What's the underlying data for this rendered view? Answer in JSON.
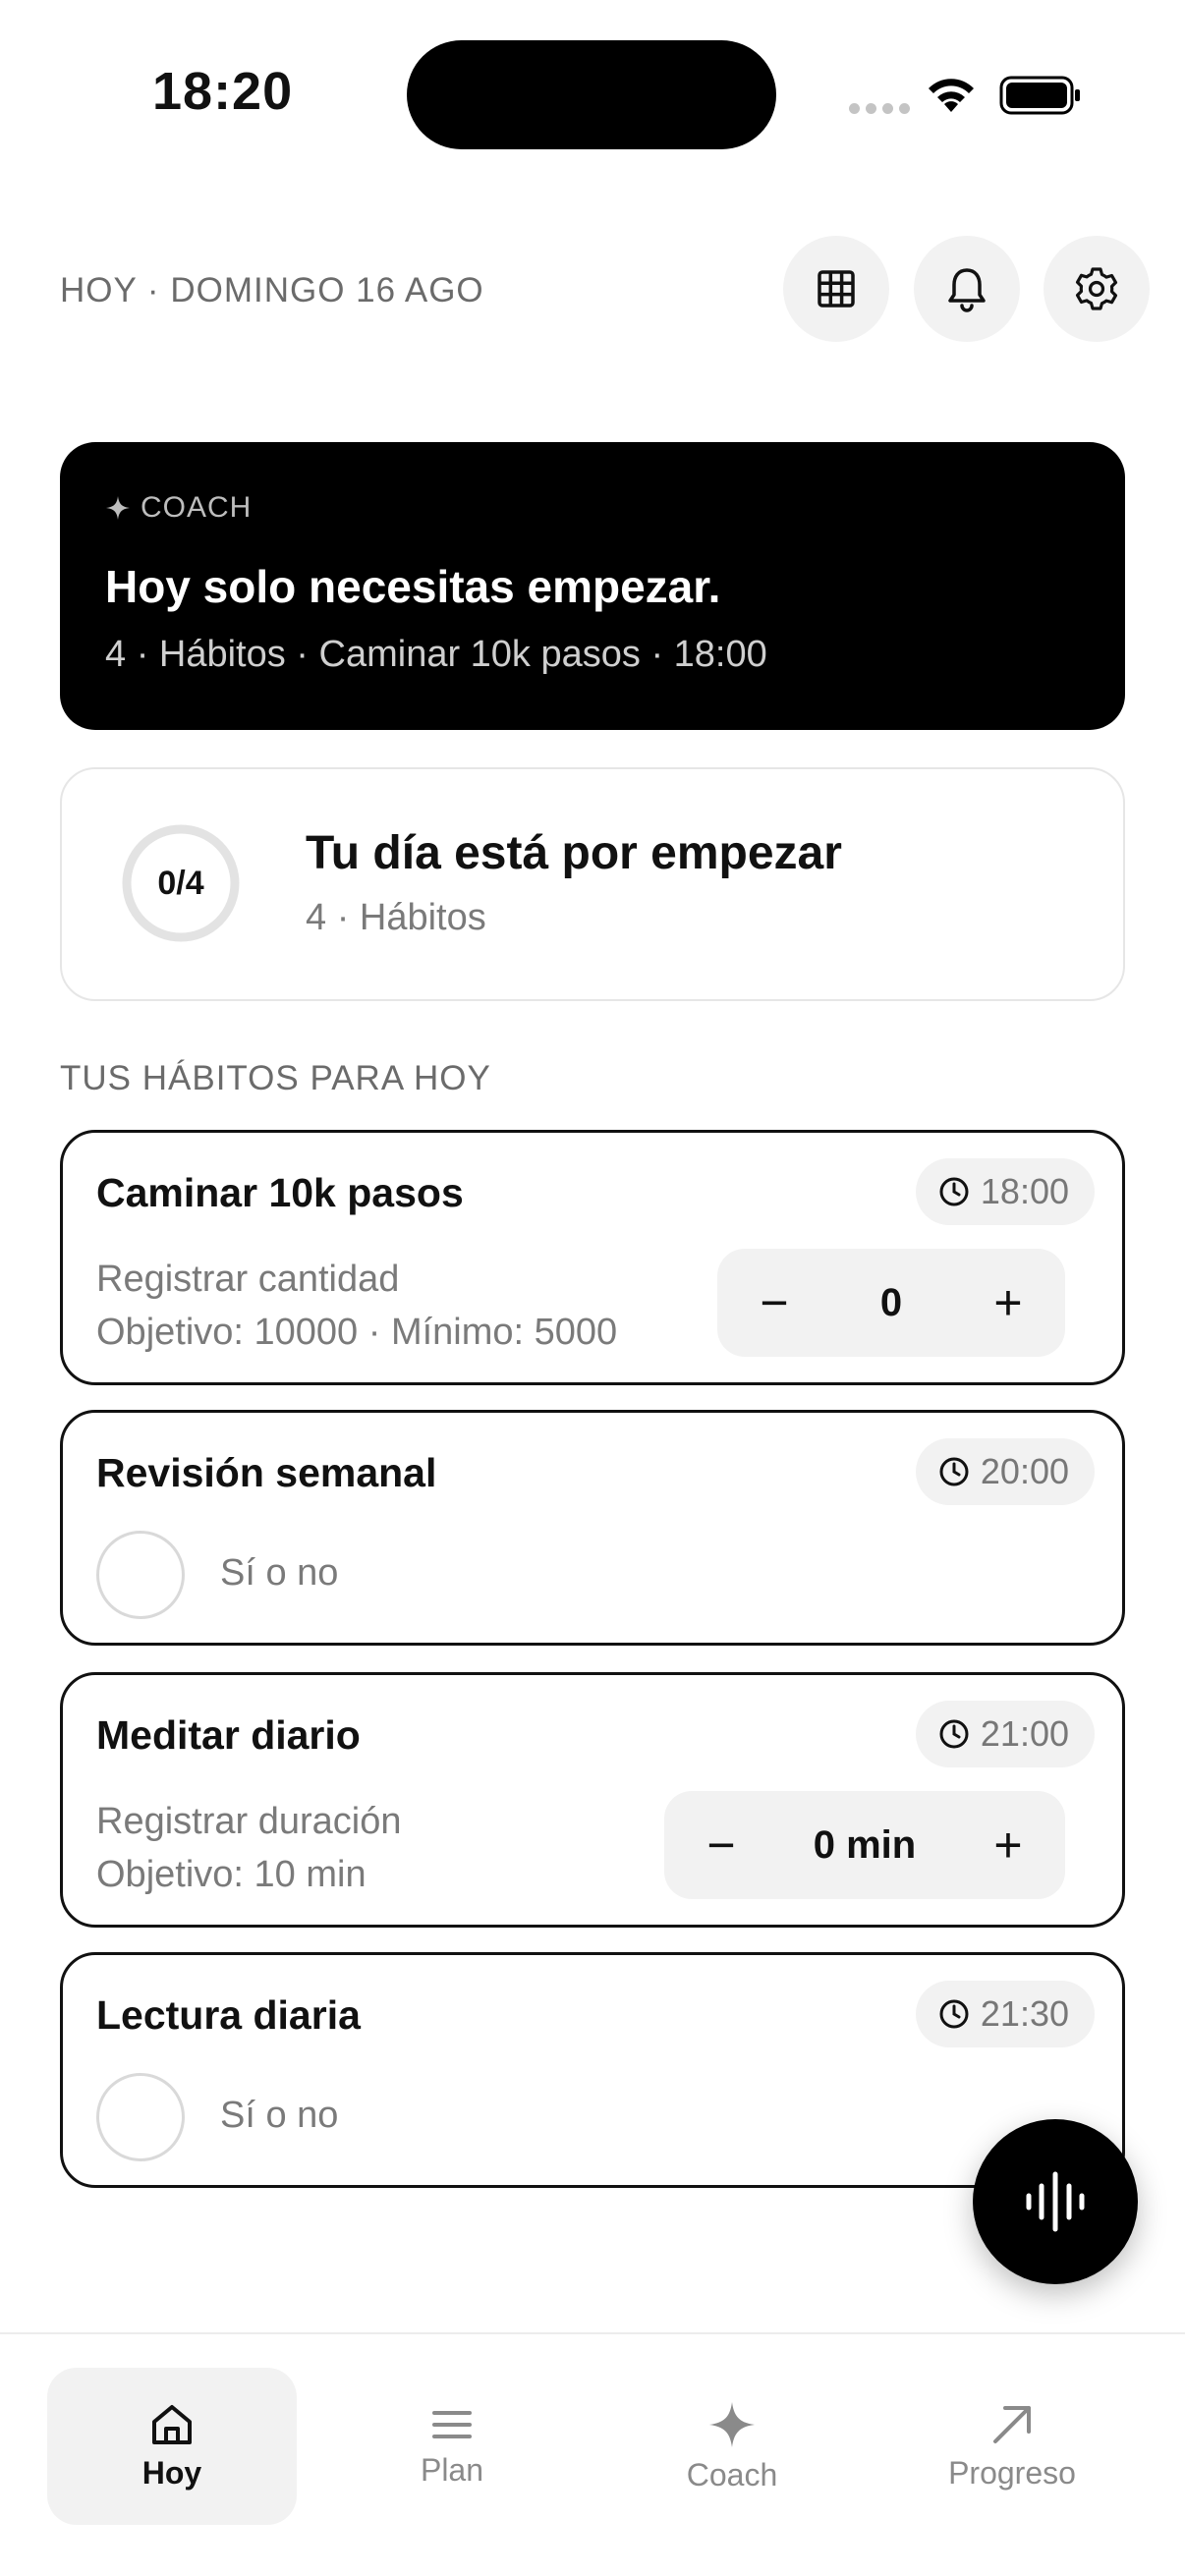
{
  "status_bar": {
    "time": "18:20"
  },
  "header": {
    "date_label": "HOY · DOMINGO 16 AGO"
  },
  "coach_card": {
    "kicker": "COACH",
    "title": "Hoy solo necesitas empezar.",
    "subtitle": "4 · Hábitos · Caminar 10k pasos · 18:00"
  },
  "progress_card": {
    "ring_label": "0/4",
    "completed_fraction": 0,
    "title": "Tu día está por empezar",
    "subtitle": "4 · Hábitos"
  },
  "section_title": "TUS HÁBITOS PARA HOY",
  "habits": [
    {
      "name": "Caminar 10k pasos",
      "time": "18:00",
      "line1": "Registrar cantidad",
      "line2": "Objetivo: 10000 · Mínimo: 5000",
      "value": "0",
      "minus": "−",
      "plus": "+"
    },
    {
      "name": "Revisión semanal",
      "time": "20:00",
      "check_label": "Sí o no"
    },
    {
      "name": "Meditar diario",
      "time": "21:00",
      "line1": "Registrar duración",
      "line2": "Objetivo: 10 min",
      "value": "0 min",
      "minus": "−",
      "plus": "+"
    },
    {
      "name": "Lectura diaria",
      "time": "21:30",
      "check_label": "Sí o no"
    }
  ],
  "bottom_nav": {
    "items": [
      {
        "label": "Hoy",
        "icon": "home-icon",
        "active": true
      },
      {
        "label": "Plan",
        "icon": "menu-icon",
        "active": false
      },
      {
        "label": "Coach",
        "icon": "sparkle-icon",
        "active": false
      },
      {
        "label": "Progreso",
        "icon": "arrow-up-right-icon",
        "active": false
      }
    ]
  },
  "colors": {
    "accent": "#000000",
    "muted_text": "#7a7a7a",
    "chip_bg": "#f2f2f2"
  }
}
